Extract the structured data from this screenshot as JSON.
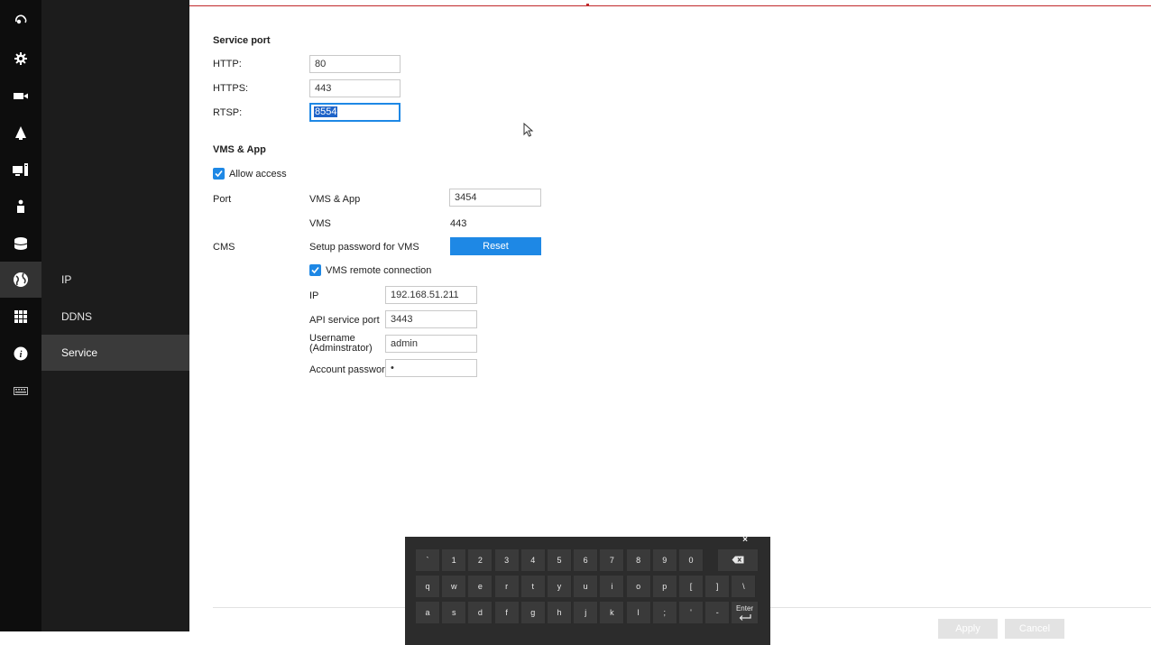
{
  "icon_sidebar": {
    "items": [
      {
        "icon": "eye-logo-icon"
      },
      {
        "icon": "gear-icon"
      },
      {
        "icon": "camera-icon"
      },
      {
        "icon": "alarm-bell-icon"
      },
      {
        "icon": "display-icon"
      },
      {
        "icon": "user-icon"
      },
      {
        "icon": "storage-icon"
      },
      {
        "icon": "network-globe-icon",
        "active": true
      },
      {
        "icon": "grid-apps-icon"
      },
      {
        "icon": "info-icon"
      },
      {
        "icon": "keyboard-icon"
      }
    ]
  },
  "sub_nav": {
    "items": [
      {
        "label": "IP"
      },
      {
        "label": "DDNS"
      },
      {
        "label": "Service",
        "active": true
      }
    ]
  },
  "service_port": {
    "title": "Service port",
    "http_label": "HTTP:",
    "http_value": "80",
    "https_label": "HTTPS:",
    "https_value": "443",
    "rtsp_label": "RTSP:",
    "rtsp_value": "8554"
  },
  "vms_app": {
    "title": "VMS & App",
    "allow_access_label": "Allow access",
    "allow_access_checked": true,
    "port_label": "Port",
    "vms_app_label": "VMS & App",
    "vms_app_value": "3454",
    "vms_label": "VMS",
    "vms_value": "443"
  },
  "cms": {
    "label": "CMS",
    "setup_password_label": "Setup password for VMS",
    "reset_label": "Reset",
    "remote_connection_label": "VMS remote connection",
    "remote_connection_checked": true,
    "ip_label": "IP",
    "ip_value": "192.168.51.211",
    "api_port_label": "API service port",
    "api_port_value": "3443",
    "username_label_line1": "Username",
    "username_label_line2": "(Adminstrator)",
    "username_value": "admin",
    "password_label": "Account password",
    "password_value": "•"
  },
  "footer": {
    "apply_label": "Apply",
    "cancel_label": "Cancel"
  },
  "keyboard": {
    "close_label": "×",
    "row1": [
      "`",
      "1",
      "2",
      "3",
      "4",
      "5",
      "6",
      "7",
      "8",
      "9",
      "0"
    ],
    "row2": [
      "q",
      "w",
      "e",
      "r",
      "t",
      "y",
      "u",
      "i",
      "o",
      "p",
      "[",
      "]",
      "\\"
    ],
    "row3": [
      "a",
      "s",
      "d",
      "f",
      "g",
      "h",
      "j",
      "k",
      "l",
      ";",
      "'",
      "-"
    ],
    "enter_label": "Enter"
  },
  "colors": {
    "accent": "#1e88e5",
    "top_line": "#c0282a",
    "sidebar_bg": "#0d0d0d",
    "subnav_bg": "#1c1c1c"
  }
}
